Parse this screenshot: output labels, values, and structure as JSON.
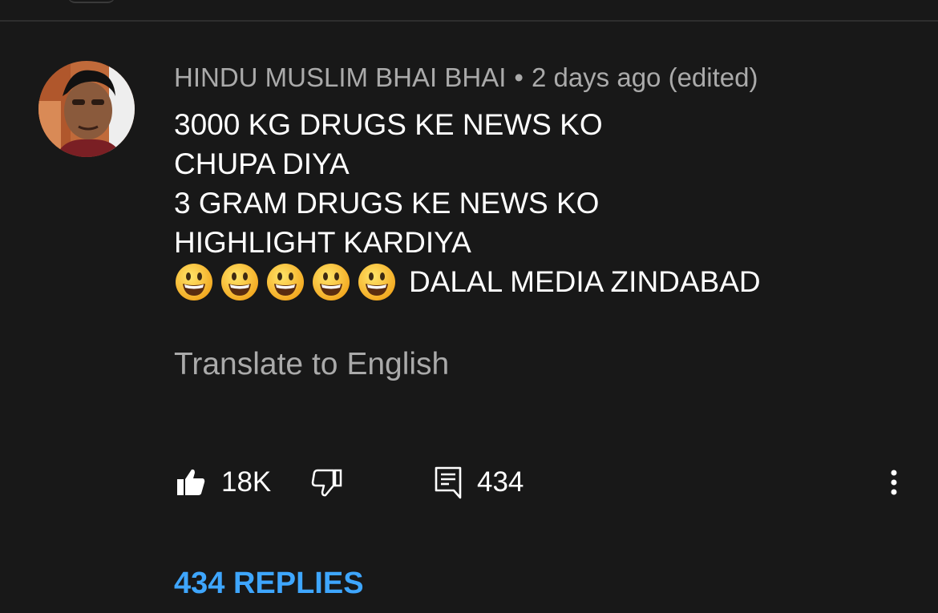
{
  "comment": {
    "author": "HINDU MUSLIM BHAI BHAI",
    "separator": "•",
    "timestamp": "2 days ago (edited)",
    "lines": [
      "3000 KG DRUGS KE NEWS KO",
      "CHUPA DIYA",
      "3 GRAM DRUGS KE NEWS KO",
      "HIGHLIGHT KARDIYA"
    ],
    "emoji_name": "smiling-face-emoji",
    "emoji_count": 5,
    "last_line_text": "DALAL MEDIA ZINDABAD",
    "translate_label": "Translate to English"
  },
  "actions": {
    "like_icon": "thumbs-up-icon",
    "like_count": "18K",
    "dislike_icon": "thumbs-down-icon",
    "reply_icon": "comment-icon",
    "reply_count": "434",
    "more_icon": "more-vertical-icon"
  },
  "replies": {
    "label": "434 REPLIES"
  },
  "colors": {
    "background": "#181818",
    "secondary_text": "#aaaaaa",
    "primary_text": "#ffffff",
    "link": "#3ea6ff"
  }
}
